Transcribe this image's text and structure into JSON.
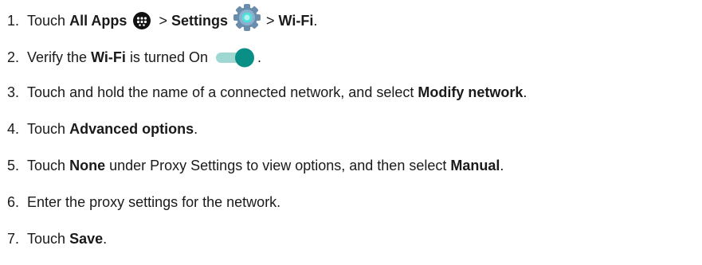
{
  "steps": [
    {
      "number": "1.",
      "text_1": "Touch",
      "all_apps": "All Apps",
      "sep_1": ">",
      "settings": "Settings",
      "sep_2": ">",
      "wifi": "Wi-Fi",
      "end": ".",
      "icons": [
        "all-apps-icon",
        "settings-gear-icon"
      ]
    },
    {
      "number": "2.",
      "text_1": "Verify the",
      "wifi": "Wi-Fi",
      "text_2": "is turned On",
      "end": ".",
      "toggle_state": "on",
      "toggle_color": "#0a8f86"
    },
    {
      "number": "3.",
      "text_1": "Touch and hold the name of a connected network, and select",
      "bold_1": "Modify network",
      "end": "."
    },
    {
      "number": "4.",
      "text_1": "Touch",
      "bold_1": "Advanced options",
      "end": "."
    },
    {
      "number": "5.",
      "text_1": "Touch",
      "bold_1": "None",
      "text_2": "under Proxy Settings to view options, and then select",
      "bold_2": "Manual",
      "end": "."
    },
    {
      "number": "6.",
      "text_1": "Enter the proxy settings for the network."
    },
    {
      "number": "7.",
      "text_1": "Touch",
      "bold_1": "Save",
      "end": "."
    }
  ]
}
